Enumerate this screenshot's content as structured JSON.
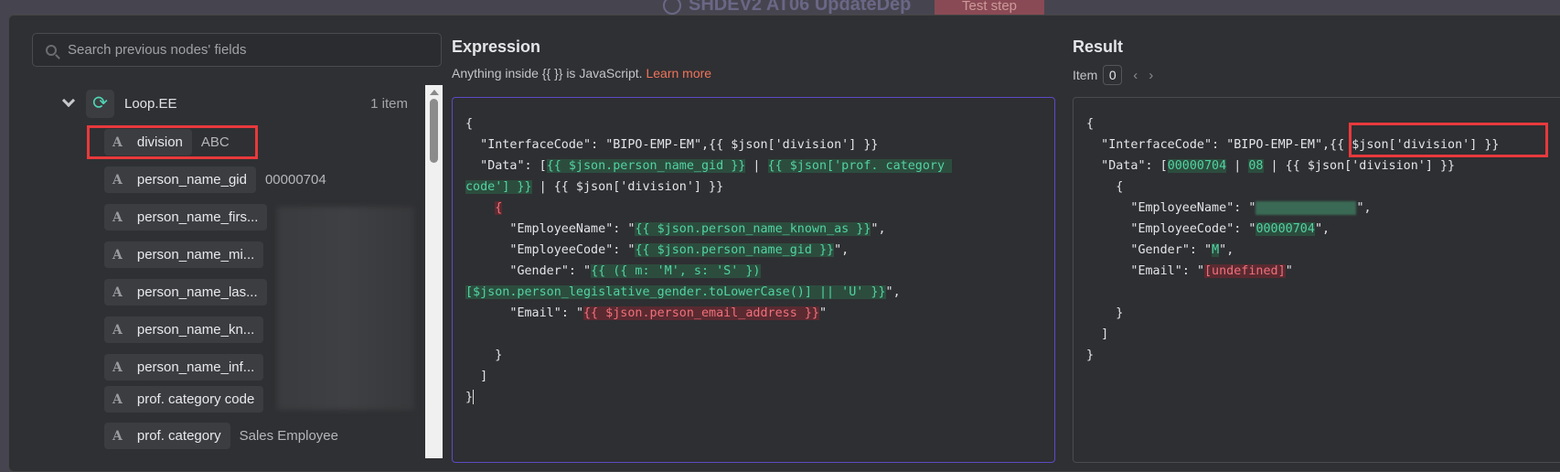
{
  "topbar": {
    "workflow_title": "SHDEV2 AT06 UpdateDep",
    "test_step_label": "Test step"
  },
  "left": {
    "search_placeholder": "Search previous nodes' fields",
    "node": {
      "name": "Loop.EE",
      "count": "1 item"
    },
    "fields": [
      {
        "name": "division",
        "value": "ABC",
        "highlighted": true
      },
      {
        "name": "person_name_gid",
        "value": "00000704"
      },
      {
        "name": "person_name_firs...",
        "value": ""
      },
      {
        "name": "person_name_mi...",
        "value": ""
      },
      {
        "name": "person_name_las...",
        "value": ""
      },
      {
        "name": "person_name_kn...",
        "value": ""
      },
      {
        "name": "person_name_inf...",
        "value": ""
      },
      {
        "name": "prof. category code",
        "value": ""
      },
      {
        "name": "prof. category",
        "value": "Sales Employee"
      }
    ]
  },
  "expression": {
    "title": "Expression",
    "hint": "Anything inside {{  }} is JavaScript.",
    "learn_more": "Learn more",
    "lines": [
      [
        {
          "t": "{"
        }
      ],
      [
        {
          "t": "  "
        },
        {
          "dq": 1
        },
        {
          "t": "InterfaceCode"
        },
        {
          "dq": 1
        },
        {
          "t": ": "
        },
        {
          "dq": 1
        },
        {
          "t": "BIPO-EMP-EM"
        },
        {
          "dq": 1
        },
        {
          "t": ",{{ $json['division'] }}"
        }
      ],
      [
        {
          "t": "  "
        },
        {
          "dq": 1
        },
        {
          "t": "Data"
        },
        {
          "dq": 1
        },
        {
          "t": ": ["
        },
        {
          "c": "g",
          "t": "{{ $json.person_name_gid }}"
        },
        {
          "t": " | "
        },
        {
          "c": "g",
          "t": "{{ $json['prof. category "
        }
      ],
      [
        {
          "c": "g",
          "t": "code'] }}"
        },
        {
          "t": " | {{ $json['division'] }}"
        }
      ],
      [
        {
          "t": "    "
        },
        {
          "c": "r",
          "t": "{"
        }
      ],
      [
        {
          "t": "      "
        },
        {
          "dq": 1
        },
        {
          "t": "EmployeeName"
        },
        {
          "dq": 1
        },
        {
          "t": ": "
        },
        {
          "dq": 1
        },
        {
          "c": "g",
          "t": "{{ $json.person_name_known_as }}"
        },
        {
          "dq": 1
        },
        {
          "t": ","
        }
      ],
      [
        {
          "t": "      "
        },
        {
          "dq": 1
        },
        {
          "t": "EmployeeCode"
        },
        {
          "dq": 1
        },
        {
          "t": ": "
        },
        {
          "dq": 1
        },
        {
          "c": "g",
          "t": "{{ $json.person_name_gid }}"
        },
        {
          "dq": 1
        },
        {
          "t": ","
        }
      ],
      [
        {
          "t": "      "
        },
        {
          "dq": 1
        },
        {
          "t": "Gender"
        },
        {
          "dq": 1
        },
        {
          "t": ": "
        },
        {
          "dq": 1
        },
        {
          "c": "g",
          "t": "{{ ({ m: 'M', s: 'S' })"
        }
      ],
      [
        {
          "c": "g",
          "t": "[$json.person_legislative_gender.toLowerCase()] || 'U' }}"
        },
        {
          "dq": 1
        },
        {
          "t": ","
        }
      ],
      [
        {
          "t": "      "
        },
        {
          "dq": 1
        },
        {
          "t": "Email"
        },
        {
          "dq": 1
        },
        {
          "t": ": "
        },
        {
          "dq": 1
        },
        {
          "c": "r",
          "t": "{{ $json.person_email_address }}"
        },
        {
          "dq": 1
        }
      ],
      [],
      [
        {
          "t": "    }"
        }
      ],
      [
        {
          "t": "  ]"
        }
      ],
      [
        {
          "t": "}"
        }
      ]
    ]
  },
  "result": {
    "title": "Result",
    "item_label": "Item",
    "item_index": "0",
    "lines": [
      [
        {
          "t": "{"
        }
      ],
      [
        {
          "t": "  "
        },
        {
          "dq": 1
        },
        {
          "t": "InterfaceCode"
        },
        {
          "dq": 1
        },
        {
          "t": ": "
        },
        {
          "dq": 1
        },
        {
          "t": "BIPO-EMP-EM"
        },
        {
          "dq": 1
        },
        {
          "t": ",{{ $json['division'] }}"
        }
      ],
      [
        {
          "t": "  "
        },
        {
          "dq": 1
        },
        {
          "t": "Data"
        },
        {
          "dq": 1
        },
        {
          "t": ": ["
        },
        {
          "c": "g",
          "t": "00000704"
        },
        {
          "t": " | "
        },
        {
          "c": "g",
          "t": "08"
        },
        {
          "t": " | {{ $json['division'] }}"
        }
      ],
      [
        {
          "t": "    {"
        }
      ],
      [
        {
          "t": "      "
        },
        {
          "dq": 1
        },
        {
          "t": "EmployeeName"
        },
        {
          "dq": 1
        },
        {
          "t": ": "
        },
        {
          "dq": 1
        },
        {
          "blur": 1
        },
        {
          "dq": 1
        },
        {
          "t": ","
        }
      ],
      [
        {
          "t": "      "
        },
        {
          "dq": 1
        },
        {
          "t": "EmployeeCode"
        },
        {
          "dq": 1
        },
        {
          "t": ": "
        },
        {
          "dq": 1
        },
        {
          "c": "g",
          "t": "00000704"
        },
        {
          "dq": 1
        },
        {
          "t": ","
        }
      ],
      [
        {
          "t": "      "
        },
        {
          "dq": 1
        },
        {
          "t": "Gender"
        },
        {
          "dq": 1
        },
        {
          "t": ": "
        },
        {
          "dq": 1
        },
        {
          "c": "g",
          "t": "M"
        },
        {
          "dq": 1
        },
        {
          "t": ","
        }
      ],
      [
        {
          "t": "      "
        },
        {
          "dq": 1
        },
        {
          "t": "Email"
        },
        {
          "dq": 1
        },
        {
          "t": ": "
        },
        {
          "dq": 1
        },
        {
          "c": "r",
          "t": "[undefined]"
        },
        {
          "dq": 1
        }
      ],
      [],
      [
        {
          "t": "    }"
        }
      ],
      [
        {
          "t": "  ]"
        }
      ],
      [
        {
          "t": "}"
        }
      ]
    ]
  }
}
